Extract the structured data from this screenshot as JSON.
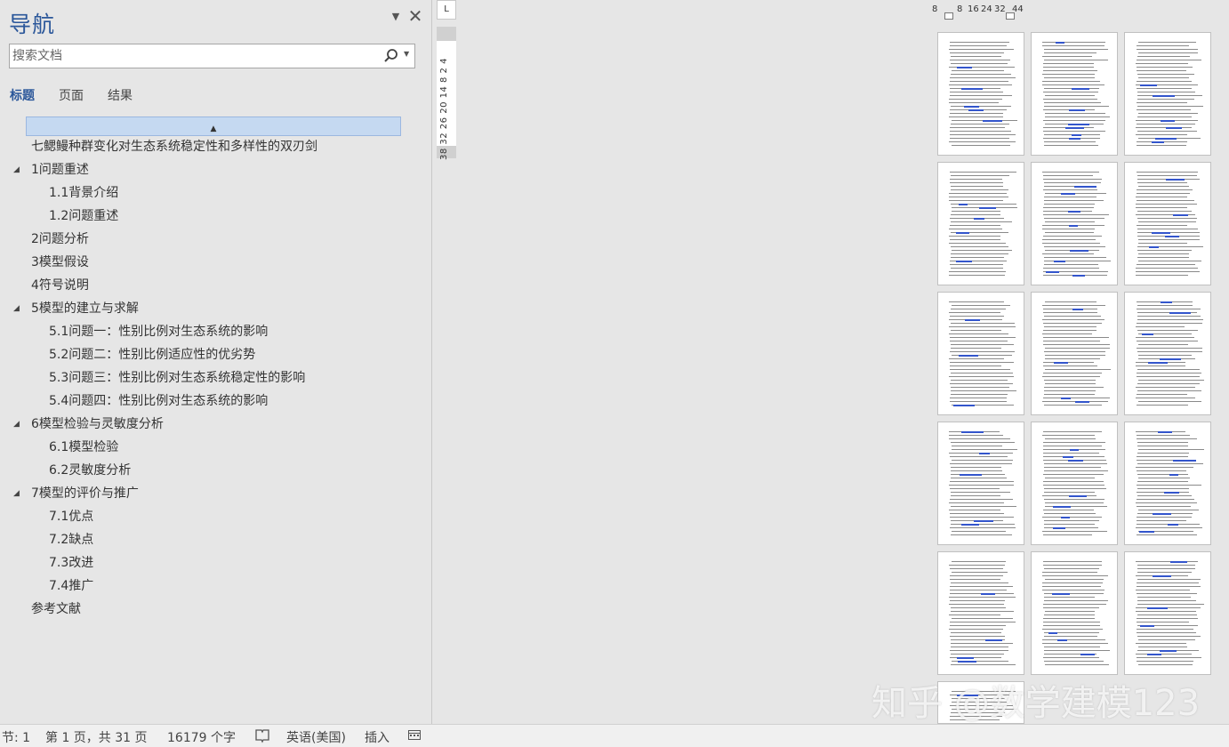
{
  "nav": {
    "title": "导航",
    "search_placeholder": "搜索文档",
    "tabs": [
      "标题",
      "页面",
      "结果"
    ],
    "headings": [
      {
        "text": "七鳃鳗种群变化对生态系统稳定性和多样性的双刃剑",
        "level": 1,
        "collapsible": false
      },
      {
        "text": "1问题重述",
        "level": 1,
        "collapsible": true
      },
      {
        "text": "1.1背景介绍",
        "level": 2,
        "collapsible": false
      },
      {
        "text": "1.2问题重述",
        "level": 2,
        "collapsible": false
      },
      {
        "text": "2问题分析",
        "level": 1,
        "collapsible": false
      },
      {
        "text": "3模型假设",
        "level": 1,
        "collapsible": false
      },
      {
        "text": "4符号说明",
        "level": 1,
        "collapsible": false
      },
      {
        "text": "5模型的建立与求解",
        "level": 1,
        "collapsible": true
      },
      {
        "text": "5.1问题一：性别比例对生态系统的影响",
        "level": 2,
        "collapsible": false
      },
      {
        "text": "5.2问题二：性别比例适应性的优劣势",
        "level": 2,
        "collapsible": false
      },
      {
        "text": "5.3问题三：性别比例对生态系统稳定性的影响",
        "level": 2,
        "collapsible": false
      },
      {
        "text": "5.4问题四：性别比例对生态系统的影响",
        "level": 2,
        "collapsible": false
      },
      {
        "text": "6模型检验与灵敏度分析",
        "level": 1,
        "collapsible": true
      },
      {
        "text": "6.1模型检验",
        "level": 2,
        "collapsible": false
      },
      {
        "text": "6.2灵敏度分析",
        "level": 2,
        "collapsible": false
      },
      {
        "text": "7模型的评价与推广",
        "level": 1,
        "collapsible": true
      },
      {
        "text": "7.1优点",
        "level": 2,
        "collapsible": false
      },
      {
        "text": "7.2缺点",
        "level": 2,
        "collapsible": false
      },
      {
        "text": "7.3改进",
        "level": 2,
        "collapsible": false
      },
      {
        "text": "7.4推广",
        "level": 2,
        "collapsible": false
      },
      {
        "text": "参考文献",
        "level": 1,
        "collapsible": false
      }
    ]
  },
  "ruler": {
    "corner": "L",
    "vertical": "38 32 26 20 14  8  2  4",
    "horizontal": [
      "8",
      "8",
      "16",
      "24",
      "32",
      "44"
    ]
  },
  "watermark": "知乎 @数学建模123",
  "status": {
    "section": "节: 1",
    "page": "第 1 页，共 31 页",
    "words": "16179 个字",
    "language": "英语(美国)",
    "mode": "插入"
  },
  "colors": {
    "accent": "#2b579a",
    "selection": "#c5d9f1"
  }
}
